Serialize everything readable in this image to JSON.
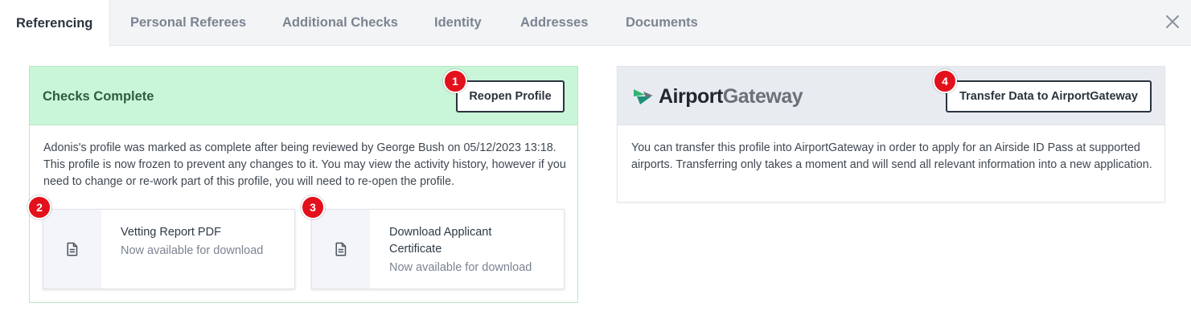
{
  "tabs": [
    {
      "label": "Referencing",
      "active": true
    },
    {
      "label": "Personal Referees",
      "active": false
    },
    {
      "label": "Additional Checks",
      "active": false
    },
    {
      "label": "Identity",
      "active": false
    },
    {
      "label": "Addresses",
      "active": false
    },
    {
      "label": "Documents",
      "active": false
    }
  ],
  "close_icon": "close-icon",
  "checks": {
    "title": "Checks Complete",
    "reopen_label": "Reopen Profile",
    "body": "Adonis's profile was marked as complete after being reviewed by George Bush on 05/12/2023 13:18. This profile is now frozen to prevent any changes to it. You may view the activity history, however if you need to change or re-work part of this profile, you will need to re-open the profile.",
    "downloads": [
      {
        "title": "Vetting Report PDF",
        "subtitle": "Now available for download",
        "icon": "document-icon"
      },
      {
        "title": "Download Applicant Certificate",
        "subtitle": "Now available for download",
        "icon": "document-icon"
      }
    ]
  },
  "airport": {
    "logo_part1": "Airport",
    "logo_part2": "Gateway",
    "transfer_label": "Transfer Data to AirportGateway",
    "body": "You can transfer this profile into AirportGateway in order to apply for an Airside ID Pass at supported airports. Transferring only takes a moment and will send all relevant information into a new application."
  },
  "markers": [
    "1",
    "2",
    "3",
    "4"
  ],
  "colors": {
    "checks_header_bg": "#c9f5d8",
    "checks_border": "#b6e7c4",
    "airport_header_bg": "#e8ecf1",
    "marker_red": "#e3111b",
    "logo_green": "#2fb573",
    "logo_teal": "#1f8f7a"
  }
}
